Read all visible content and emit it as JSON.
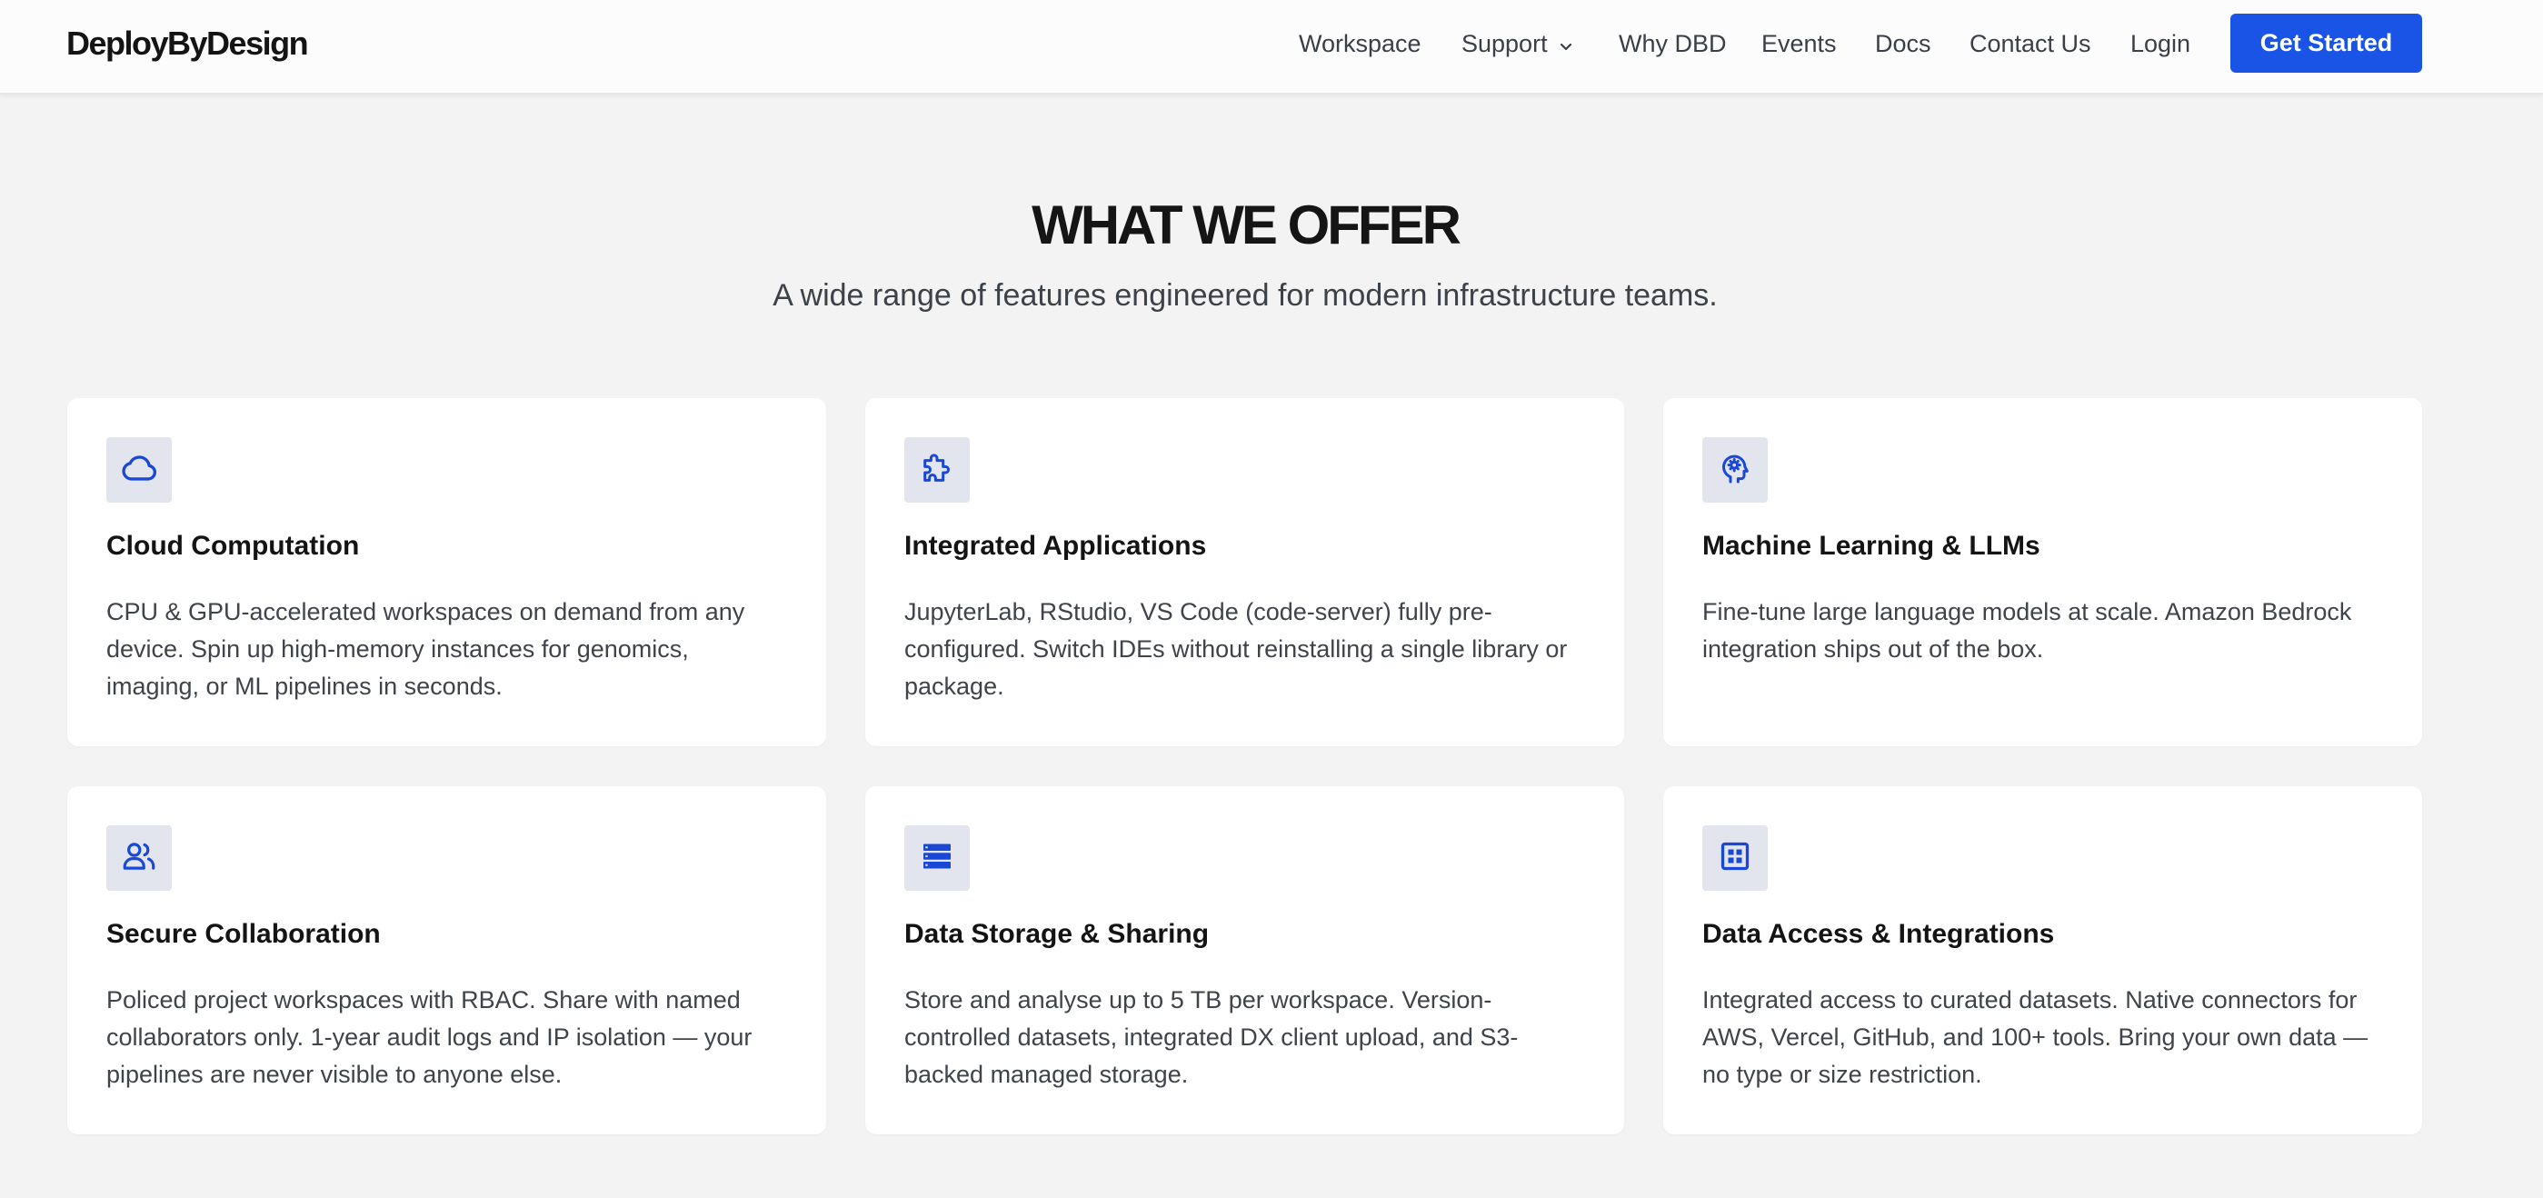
{
  "header": {
    "logo": "DeployByDesign",
    "nav": [
      {
        "label": "Workspace"
      },
      {
        "label": "Support"
      },
      {
        "label": "Why DBD"
      },
      {
        "label": "Events"
      },
      {
        "label": "Docs"
      },
      {
        "label": "Contact Us"
      },
      {
        "label": "Login"
      }
    ],
    "cta_label": "Get Started"
  },
  "section": {
    "title": "WHAT WE OFFER",
    "subtitle": "A wide range of features engineered for modern infrastructure teams."
  },
  "features": [
    {
      "icon": "cloud-icon",
      "title": "Cloud Computation",
      "description": "CPU & GPU-accelerated workspaces on demand from any device. Spin up high-memory instances for genomics, imaging, or ML pipelines in seconds."
    },
    {
      "icon": "puzzle-icon",
      "title": "Integrated Applications",
      "description": "JupyterLab, RStudio, VS Code (code-server) fully pre-configured. Switch IDEs without reinstalling a single library or package."
    },
    {
      "icon": "brain-gear-icon",
      "title": "Machine Learning & LLMs",
      "description": "Fine-tune large language models at scale. Amazon Bedrock integration ships out of the box."
    },
    {
      "icon": "users-icon",
      "title": "Secure Collaboration",
      "description": "Policed project workspaces with RBAC. Share with named collaborators only. 1-year audit logs and IP isolation — your pipelines are never visible to anyone else."
    },
    {
      "icon": "server-icon",
      "title": "Data Storage & Sharing",
      "description": "Store and analyse up to 5 TB per workspace. Version-controlled datasets, integrated DX client upload, and S3-backed managed storage."
    },
    {
      "icon": "grid-icon",
      "title": "Data Access & Integrations",
      "description": "Integrated access to curated datasets. Native connectors for AWS, Vercel, GitHub, and 100+ tools. Bring your own data — no type or size restriction."
    }
  ],
  "colors": {
    "accent": "#1a54e6",
    "icon_stroke": "#1a48d6",
    "icon_tile": "#e2e4ee",
    "page_background": "#f2f3f2"
  }
}
